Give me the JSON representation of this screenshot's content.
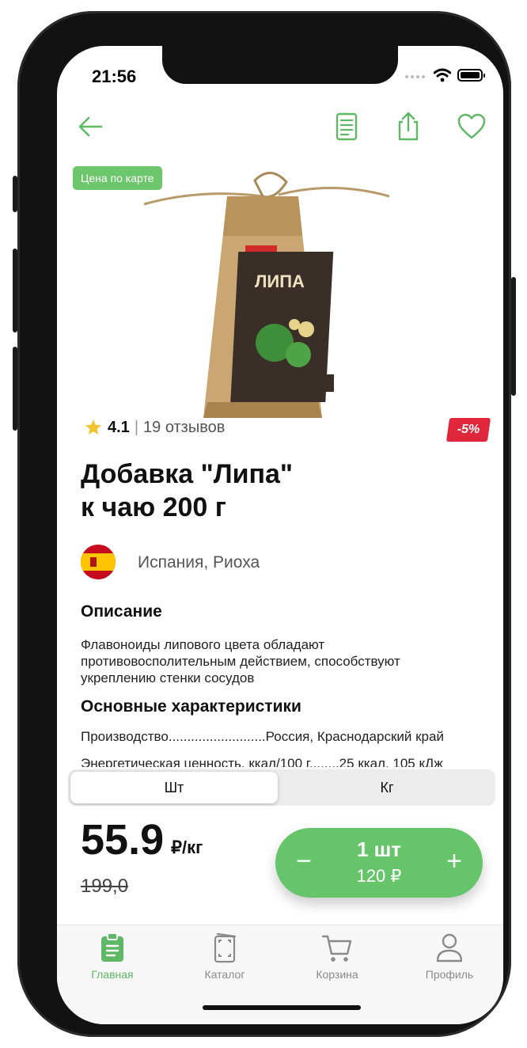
{
  "status": {
    "time": "21:56"
  },
  "product": {
    "badge": "Цена по карте",
    "rating": "4.1",
    "reviews": "19 отзывов",
    "discount": "-5%",
    "title_line1": "Добавка \"Липа\"",
    "title_line2": "к чаю 200 г",
    "origin": "Испания, Риоха"
  },
  "description": {
    "heading": "Описание",
    "text": "Флавоноиды липового цвета обладают противовосполительным действием, способствуют укреплению стенки сосудов"
  },
  "characteristics": {
    "heading": "Основные характеристики",
    "rows": [
      "Производство..........................Россия, Краснодарский край",
      "Энергетическая ценность, ккал/100 г........25 ккал, 105 кДж"
    ]
  },
  "unit_selector": {
    "options": [
      "Шт",
      "Кг"
    ],
    "selected": "Шт"
  },
  "pricing": {
    "price": "55.9",
    "unit": "₽/кг",
    "old_price": "199,0"
  },
  "cart": {
    "minus": "−",
    "quantity": "1 шт",
    "sum": "120 ₽",
    "plus": "+"
  },
  "tabbar": {
    "items": [
      {
        "label": "Главная",
        "icon": "home-clipboard-icon",
        "active": true
      },
      {
        "label": "Каталог",
        "icon": "catalog-icon",
        "active": false
      },
      {
        "label": "Корзина",
        "icon": "cart-icon",
        "active": false
      },
      {
        "label": "Профиль",
        "icon": "profile-icon",
        "active": false
      }
    ]
  },
  "colors": {
    "accent": "#66c56b",
    "discount": "#e0263a"
  }
}
